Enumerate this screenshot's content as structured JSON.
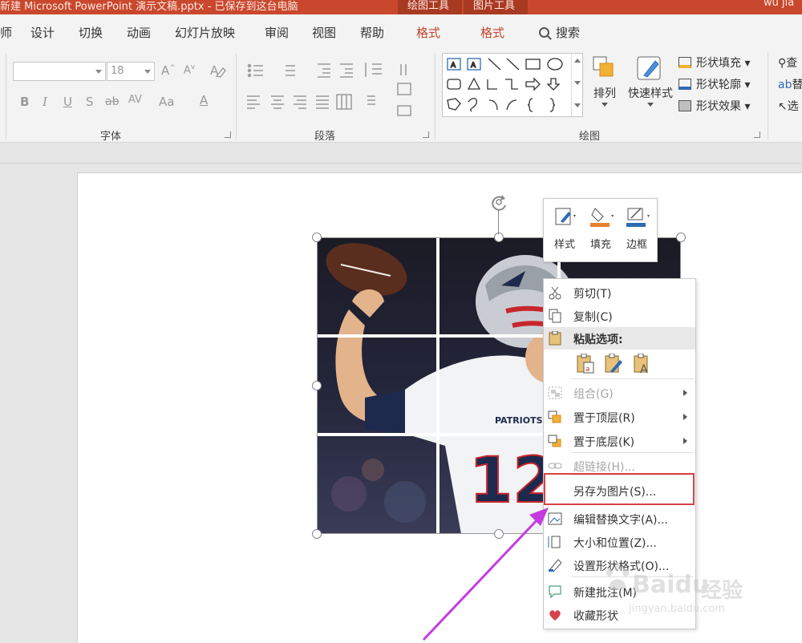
{
  "titlebar": {
    "document": "新建 Microsoft PowerPoint 演示文稿.pptx - 已保存到这台电脑",
    "context_tab_1": "绘图工具",
    "context_tab_2": "图片工具",
    "user": "wu jia"
  },
  "tabs": [
    {
      "label": "师"
    },
    {
      "label": "设计"
    },
    {
      "label": "切换"
    },
    {
      "label": "动画"
    },
    {
      "label": "幻灯片放映"
    },
    {
      "label": "审阅"
    },
    {
      "label": "视图"
    },
    {
      "label": "帮助"
    },
    {
      "label": "格式"
    },
    {
      "label": "格式"
    }
  ],
  "tellme": "搜索",
  "ribbon": {
    "font": {
      "font_name_value": "",
      "font_size_value": "18",
      "grow": "A",
      "shrink": "A",
      "bold": "B",
      "italic": "I",
      "underline": "U",
      "shadow": "S",
      "strike": "ab",
      "spacing": "AV",
      "case": "Aa",
      "color": "A",
      "label": "字体"
    },
    "paragraph": {
      "label": "段落"
    },
    "drawing": {
      "arrange_label": "排列",
      "quick_styles_label": "快速样式",
      "shape_fill": "形状填充",
      "shape_outline": "形状轮廓",
      "shape_effects": "形状效果",
      "label": "绘图"
    },
    "editing": {
      "find": "查",
      "replace": "替",
      "select": "选"
    }
  },
  "mini_toolbar": {
    "style": "样式",
    "fill": "填充",
    "border": "边框"
  },
  "context_menu": {
    "cut": "剪切(T)",
    "copy": "复制(C)",
    "paste_options": "粘贴选项:",
    "group": "组合(G)",
    "bring_to_front": "置于顶层(R)",
    "send_to_back": "置于底层(K)",
    "hyperlink": "超链接(H)...",
    "save_as_picture": "另存为图片(S)...",
    "edit_alt_text": "编辑替换文字(A)...",
    "size_position": "大小和位置(Z)...",
    "format_shape": "设置形状格式(O)...",
    "new_comment": "新建批注(M)",
    "favorite_shape": "收藏形状"
  },
  "watermark": {
    "brand": "Baidu",
    "brand2": "经验",
    "url": "jingyan.baidu.com"
  },
  "colors": {
    "titlebar": "#c9482d",
    "accent_tab": "#c4452b",
    "highlight_box": "#d9414a",
    "annotation_arrow": "#c43be0"
  }
}
